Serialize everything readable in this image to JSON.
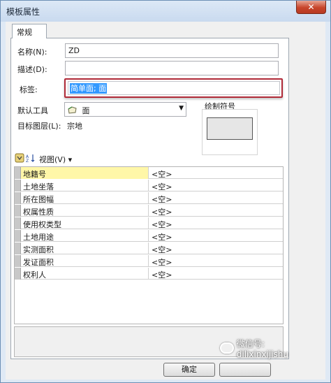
{
  "window": {
    "title": "模板属性",
    "close_glyph": "✕"
  },
  "tabs": [
    {
      "label": "常规"
    }
  ],
  "form": {
    "name_label": "名称(N):",
    "name_value": "ZD",
    "desc_label": "描述(D):",
    "desc_value": "",
    "tag_label": "标签:",
    "tag_value": "简单面; 面",
    "tool_label": "默认工具",
    "tool_value": "面",
    "tool_icon": "polygon-tool-icon",
    "target_label": "目标图层(L):",
    "target_value": "宗地",
    "symbol_label": "绘制符号"
  },
  "toolbar": {
    "view_label": "视图(V)",
    "view_arrow": "▾"
  },
  "attributes": [
    {
      "name": "地籍号",
      "value": "<空>",
      "selected": true
    },
    {
      "name": "土地坐落",
      "value": "<空>"
    },
    {
      "name": "所在图幅",
      "value": "<空>"
    },
    {
      "name": "权属性质",
      "value": "<空>"
    },
    {
      "name": "使用权类型",
      "value": "<空>"
    },
    {
      "name": "土地用途",
      "value": "<空>"
    },
    {
      "name": "实测面积",
      "value": "<空>"
    },
    {
      "name": "发证面积",
      "value": "<空>"
    },
    {
      "name": "权利人",
      "value": "<空>"
    }
  ],
  "buttons": {
    "ok_label": "确定"
  },
  "watermark": {
    "text": "微信号: dilixinxijishu"
  },
  "colors": {
    "highlight_row": "#fff7a8",
    "selection": "#3399ff",
    "annotation_border": "#b02a38"
  }
}
